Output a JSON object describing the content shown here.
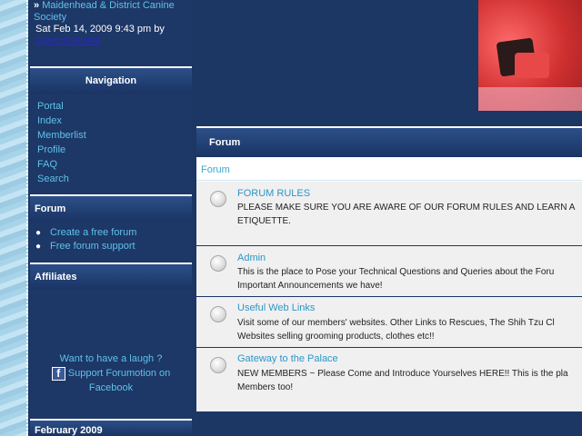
{
  "latest_post": {
    "bullet": "»",
    "topic": "Maidenhead & District Canine",
    "topic_line2": "Society",
    "date": "Sat Feb 14, 2009 9:43 pm by",
    "author": "SpecialSerene"
  },
  "navigation": {
    "title": "Navigation",
    "links": [
      "Portal",
      "Index",
      "Memberlist",
      "Profile",
      "FAQ",
      "Search"
    ]
  },
  "forum_block": {
    "title": "Forum",
    "links": [
      "Create a free forum",
      "Free forum support"
    ]
  },
  "affiliates": {
    "title": "Affiliates"
  },
  "facebook": {
    "line1": "Want to have a laugh ?",
    "line2": "Support Forumotion on",
    "line3": "Facebook",
    "icon_letter": "f"
  },
  "calendar": {
    "month": "February 2009"
  },
  "main": {
    "header": "Forum",
    "category": "Forum",
    "forums": [
      {
        "title": "FORUM RULES",
        "desc1": "PLEASE MAKE SURE YOU ARE AWARE OF OUR FORUM RULES AND LEARN A",
        "desc2": "ETIQUETTE."
      },
      {
        "title": "Admin",
        "desc1": "This is the place to Pose your Technical Questions and Queries about the Foru",
        "desc2": "Important Announcements we have!"
      },
      {
        "title": "Useful Web Links",
        "desc1": "Visit some of our members' websites. Other Links to Rescues, The Shih Tzu Cl",
        "desc2": "Websites selling grooming products, clothes etc!!"
      },
      {
        "title": "Gateway to the Palace",
        "desc1": "NEW MEMBERS ~ Please Come and Introduce Yourselves HERE!! This is the pla",
        "desc2": "Members too!"
      }
    ]
  },
  "colors": {
    "background": "#1c3764",
    "link": "#5fc2ea",
    "forum_title": "#2a96c8"
  }
}
